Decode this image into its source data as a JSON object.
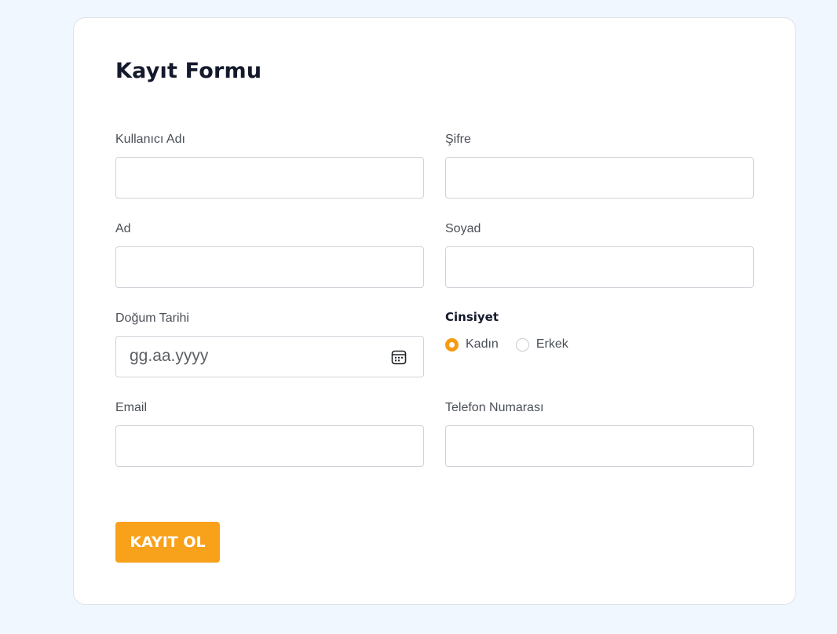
{
  "form": {
    "title": "Kayıt Formu",
    "fields": {
      "username": {
        "label": "Kullanıcı Adı",
        "value": ""
      },
      "password": {
        "label": "Şifre",
        "value": ""
      },
      "first_name": {
        "label": "Ad",
        "value": ""
      },
      "last_name": {
        "label": "Soyad",
        "value": ""
      },
      "birth_date": {
        "label": "Doğum Tarihi",
        "placeholder": "gg.aa.yyyy",
        "icon": "calendar-icon"
      },
      "email": {
        "label": "Email",
        "value": ""
      },
      "phone": {
        "label": "Telefon Numarası",
        "value": ""
      }
    },
    "gender": {
      "label": "Cinsiyet",
      "options": [
        {
          "label": "Kadın",
          "checked": true
        },
        {
          "label": "Erkek",
          "checked": false
        }
      ]
    },
    "submit_label": "KAYIT OL"
  },
  "colors": {
    "page_background": "#f1f7fe",
    "card_background": "#ffffff",
    "accent": "#f8a11b",
    "heading": "#141a2b",
    "label": "#4a4f57"
  }
}
